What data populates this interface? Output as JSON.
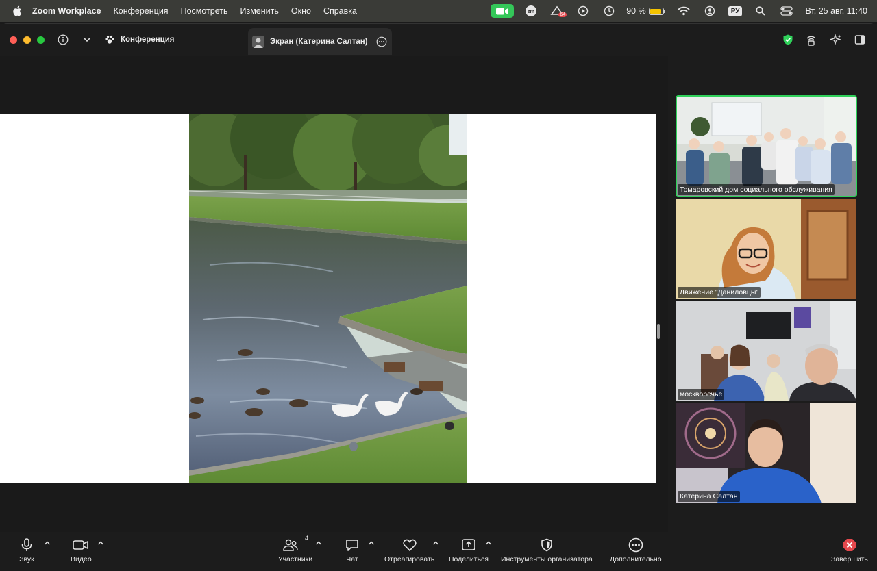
{
  "menubar": {
    "app_name": "Zoom Workplace",
    "items": [
      "Конференция",
      "Посмотреть",
      "Изменить",
      "Окно",
      "Справка"
    ],
    "battery_percent": "90 %",
    "battery_level": 0.9,
    "input_language": "РУ",
    "datetime": "Вт, 25 авг.  11:40",
    "notification_badge": "64"
  },
  "titlebar": {
    "meeting_tab_label": "Конференция",
    "screen_tab_label": "Экран (Катерина Салтан)"
  },
  "participants": [
    {
      "name": "Томаровский дом социального обслуживания",
      "active_speaker": true
    },
    {
      "name": "Движение \"Даниловцы\"",
      "active_speaker": false
    },
    {
      "name": "москворечье",
      "active_speaker": false
    },
    {
      "name": "Катерина Салтан",
      "active_speaker": false
    }
  ],
  "toolbar": {
    "audio_label": "Звук",
    "video_label": "Видео",
    "participants_label": "Участники",
    "participants_count": "4",
    "chat_label": "Чат",
    "react_label": "Отреагировать",
    "share_label": "Поделиться",
    "host_tools_label": "Инструменты организатора",
    "more_label": "Дополнительно",
    "end_label": "Завершить"
  },
  "colors": {
    "menubar_bg": "#3a3b37",
    "window_bg": "#1c1c1c",
    "active_speaker_outline": "#2fd15a",
    "end_button": "#e5484d",
    "video_indicator": "#34c759"
  }
}
